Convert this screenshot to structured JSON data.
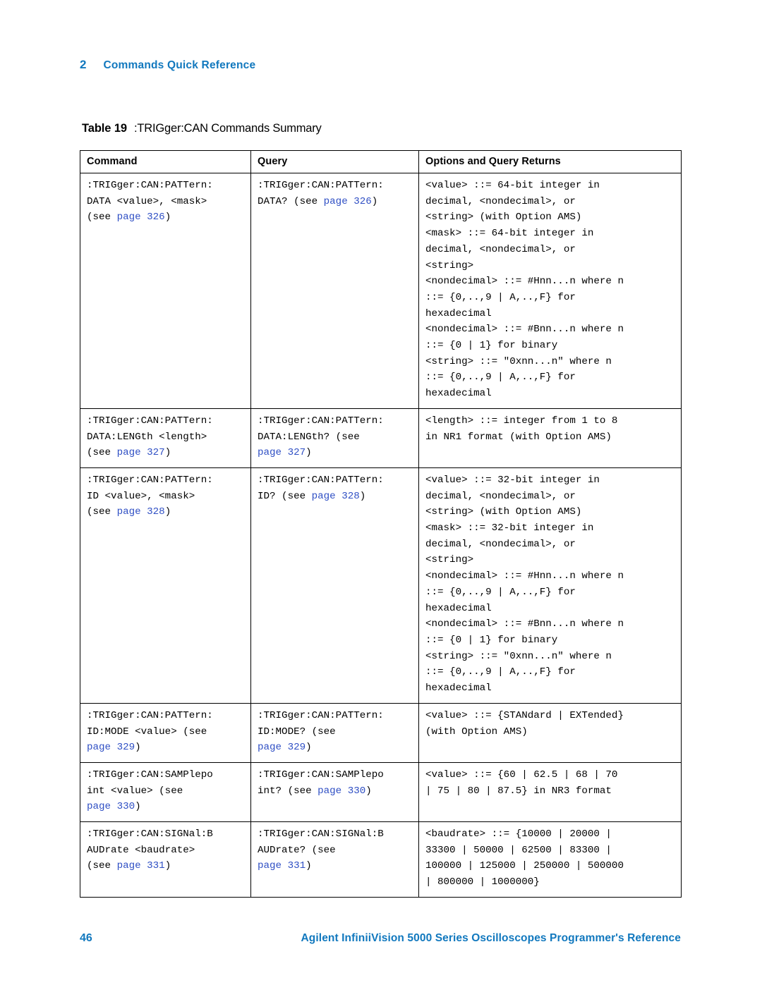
{
  "header": {
    "chapter_number": "2",
    "chapter_title": "Commands Quick Reference"
  },
  "caption": {
    "label": "Table 19",
    "text": ":TRIGger:CAN Commands Summary"
  },
  "colors": {
    "accent_blue": "#1178BE",
    "link_blue": "#2F4FC4",
    "rule": "#000000"
  },
  "table": {
    "columns": [
      "Command",
      "Query",
      "Options and Query Returns"
    ],
    "rows": [
      {
        "command": [
          {
            "segments": [
              {
                "t": ":TRIGger:CAN:PATTern:",
                "link": false
              }
            ]
          },
          {
            "segments": [
              {
                "t": "DATA <value>, <mask>",
                "link": false
              }
            ]
          },
          {
            "segments": [
              {
                "t": "(see ",
                "link": false
              },
              {
                "t": "page 326",
                "link": true
              },
              {
                "t": ")",
                "link": false
              }
            ]
          }
        ],
        "query": [
          {
            "segments": [
              {
                "t": ":TRIGger:CAN:PATTern:",
                "link": false
              }
            ]
          },
          {
            "segments": [
              {
                "t": "DATA? (see ",
                "link": false
              },
              {
                "t": "page 326",
                "link": true
              },
              {
                "t": ")",
                "link": false
              }
            ]
          }
        ],
        "options": [
          {
            "segments": [
              {
                "t": "<value> ::= 64-bit integer in",
                "link": false
              }
            ]
          },
          {
            "segments": [
              {
                "t": "decimal, <nondecimal>, or",
                "link": false
              }
            ]
          },
          {
            "segments": [
              {
                "t": "<string> (with Option AMS)",
                "link": false
              }
            ]
          },
          {
            "segments": [
              {
                "t": "<mask> ::= 64-bit integer in",
                "link": false
              }
            ]
          },
          {
            "segments": [
              {
                "t": "decimal, <nondecimal>, or",
                "link": false
              }
            ]
          },
          {
            "segments": [
              {
                "t": "<string>",
                "link": false
              }
            ]
          },
          {
            "segments": [
              {
                "t": "<nondecimal> ::= #Hnn...n where n",
                "link": false
              }
            ]
          },
          {
            "segments": [
              {
                "t": "::= {0,..,9 | A,..,F} for",
                "link": false
              }
            ]
          },
          {
            "segments": [
              {
                "t": "hexadecimal",
                "link": false
              }
            ]
          },
          {
            "segments": [
              {
                "t": "<nondecimal> ::= #Bnn...n where n",
                "link": false
              }
            ]
          },
          {
            "segments": [
              {
                "t": "::= {0 | 1} for binary",
                "link": false
              }
            ]
          },
          {
            "segments": [
              {
                "t": "<string> ::= \"0xnn...n\" where n",
                "link": false
              }
            ]
          },
          {
            "segments": [
              {
                "t": "::= {0,..,9 | A,..,F} for",
                "link": false
              }
            ]
          },
          {
            "segments": [
              {
                "t": "hexadecimal",
                "link": false
              }
            ]
          }
        ]
      },
      {
        "command": [
          {
            "segments": [
              {
                "t": ":TRIGger:CAN:PATTern:",
                "link": false
              }
            ]
          },
          {
            "segments": [
              {
                "t": "DATA:LENGth <length>",
                "link": false
              }
            ]
          },
          {
            "segments": [
              {
                "t": "(see ",
                "link": false
              },
              {
                "t": "page 327",
                "link": true
              },
              {
                "t": ")",
                "link": false
              }
            ]
          }
        ],
        "query": [
          {
            "segments": [
              {
                "t": ":TRIGger:CAN:PATTern:",
                "link": false
              }
            ]
          },
          {
            "segments": [
              {
                "t": "DATA:LENGth? (see",
                "link": false
              }
            ]
          },
          {
            "segments": [
              {
                "t": "page 327",
                "link": true
              },
              {
                "t": ")",
                "link": false
              }
            ]
          }
        ],
        "options": [
          {
            "segments": [
              {
                "t": "<length> ::= integer from 1 to 8",
                "link": false
              }
            ]
          },
          {
            "segments": [
              {
                "t": "in NR1 format (with Option AMS)",
                "link": false
              }
            ]
          }
        ]
      },
      {
        "command": [
          {
            "segments": [
              {
                "t": ":TRIGger:CAN:PATTern:",
                "link": false
              }
            ]
          },
          {
            "segments": [
              {
                "t": "ID <value>, <mask>",
                "link": false
              }
            ]
          },
          {
            "segments": [
              {
                "t": "(see ",
                "link": false
              },
              {
                "t": "page 328",
                "link": true
              },
              {
                "t": ")",
                "link": false
              }
            ]
          }
        ],
        "query": [
          {
            "segments": [
              {
                "t": ":TRIGger:CAN:PATTern:",
                "link": false
              }
            ]
          },
          {
            "segments": [
              {
                "t": "ID? (see ",
                "link": false
              },
              {
                "t": "page 328",
                "link": true
              },
              {
                "t": ")",
                "link": false
              }
            ]
          }
        ],
        "options": [
          {
            "segments": [
              {
                "t": "<value> ::= 32-bit integer in",
                "link": false
              }
            ]
          },
          {
            "segments": [
              {
                "t": "decimal, <nondecimal>, or",
                "link": false
              }
            ]
          },
          {
            "segments": [
              {
                "t": "<string> (with Option AMS)",
                "link": false
              }
            ]
          },
          {
            "segments": [
              {
                "t": "<mask> ::= 32-bit integer in",
                "link": false
              }
            ]
          },
          {
            "segments": [
              {
                "t": "decimal, <nondecimal>, or",
                "link": false
              }
            ]
          },
          {
            "segments": [
              {
                "t": "<string>",
                "link": false
              }
            ]
          },
          {
            "segments": [
              {
                "t": "<nondecimal> ::= #Hnn...n where n",
                "link": false
              }
            ]
          },
          {
            "segments": [
              {
                "t": "::= {0,..,9 | A,..,F} for",
                "link": false
              }
            ]
          },
          {
            "segments": [
              {
                "t": "hexadecimal",
                "link": false
              }
            ]
          },
          {
            "segments": [
              {
                "t": "<nondecimal> ::= #Bnn...n where n",
                "link": false
              }
            ]
          },
          {
            "segments": [
              {
                "t": "::= {0 | 1} for binary",
                "link": false
              }
            ]
          },
          {
            "segments": [
              {
                "t": "<string> ::= \"0xnn...n\" where n",
                "link": false
              }
            ]
          },
          {
            "segments": [
              {
                "t": "::= {0,..,9 | A,..,F} for",
                "link": false
              }
            ]
          },
          {
            "segments": [
              {
                "t": "hexadecimal",
                "link": false
              }
            ]
          }
        ]
      },
      {
        "command": [
          {
            "segments": [
              {
                "t": ":TRIGger:CAN:PATTern:",
                "link": false
              }
            ]
          },
          {
            "segments": [
              {
                "t": "ID:MODE <value> (see",
                "link": false
              }
            ]
          },
          {
            "segments": [
              {
                "t": "page 329",
                "link": true
              },
              {
                "t": ")",
                "link": false
              }
            ]
          }
        ],
        "query": [
          {
            "segments": [
              {
                "t": ":TRIGger:CAN:PATTern:",
                "link": false
              }
            ]
          },
          {
            "segments": [
              {
                "t": "ID:MODE? (see",
                "link": false
              }
            ]
          },
          {
            "segments": [
              {
                "t": "page 329",
                "link": true
              },
              {
                "t": ")",
                "link": false
              }
            ]
          }
        ],
        "options": [
          {
            "segments": [
              {
                "t": "<value> ::= {STANdard | EXTended}",
                "link": false
              }
            ]
          },
          {
            "segments": [
              {
                "t": "(with Option AMS)",
                "link": false
              }
            ]
          }
        ]
      },
      {
        "command": [
          {
            "segments": [
              {
                "t": ":TRIGger:CAN:SAMPlepo",
                "link": false
              }
            ]
          },
          {
            "segments": [
              {
                "t": "int <value> (see",
                "link": false
              }
            ]
          },
          {
            "segments": [
              {
                "t": "page 330",
                "link": true
              },
              {
                "t": ")",
                "link": false
              }
            ]
          }
        ],
        "query": [
          {
            "segments": [
              {
                "t": ":TRIGger:CAN:SAMPlepo",
                "link": false
              }
            ]
          },
          {
            "segments": [
              {
                "t": "int? (see ",
                "link": false
              },
              {
                "t": "page 330",
                "link": true
              },
              {
                "t": ")",
                "link": false
              }
            ]
          }
        ],
        "options": [
          {
            "segments": [
              {
                "t": "<value> ::= {60 | 62.5 | 68 | 70",
                "link": false
              }
            ]
          },
          {
            "segments": [
              {
                "t": "| 75 | 80 | 87.5} in NR3 format",
                "link": false
              }
            ]
          }
        ]
      },
      {
        "command": [
          {
            "segments": [
              {
                "t": ":TRIGger:CAN:SIGNal:B",
                "link": false
              }
            ]
          },
          {
            "segments": [
              {
                "t": "AUDrate <baudrate>",
                "link": false
              }
            ]
          },
          {
            "segments": [
              {
                "t": "(see ",
                "link": false
              },
              {
                "t": "page 331",
                "link": true
              },
              {
                "t": ")",
                "link": false
              }
            ]
          }
        ],
        "query": [
          {
            "segments": [
              {
                "t": ":TRIGger:CAN:SIGNal:B",
                "link": false
              }
            ]
          },
          {
            "segments": [
              {
                "t": "AUDrate? (see",
                "link": false
              }
            ]
          },
          {
            "segments": [
              {
                "t": "page 331",
                "link": true
              },
              {
                "t": ")",
                "link": false
              }
            ]
          }
        ],
        "options": [
          {
            "segments": [
              {
                "t": "<baudrate> ::= {10000 | 20000 |",
                "link": false
              }
            ]
          },
          {
            "segments": [
              {
                "t": "33300 | 50000 | 62500 | 83300 |",
                "link": false
              }
            ]
          },
          {
            "segments": [
              {
                "t": "100000 | 125000 | 250000 | 500000",
                "link": false
              }
            ]
          },
          {
            "segments": [
              {
                "t": "| 800000 | 1000000}",
                "link": false
              }
            ]
          }
        ]
      }
    ]
  },
  "footer": {
    "page_number": "46",
    "title": "Agilent InfiniiVision 5000 Series Oscilloscopes Programmer's Reference"
  }
}
